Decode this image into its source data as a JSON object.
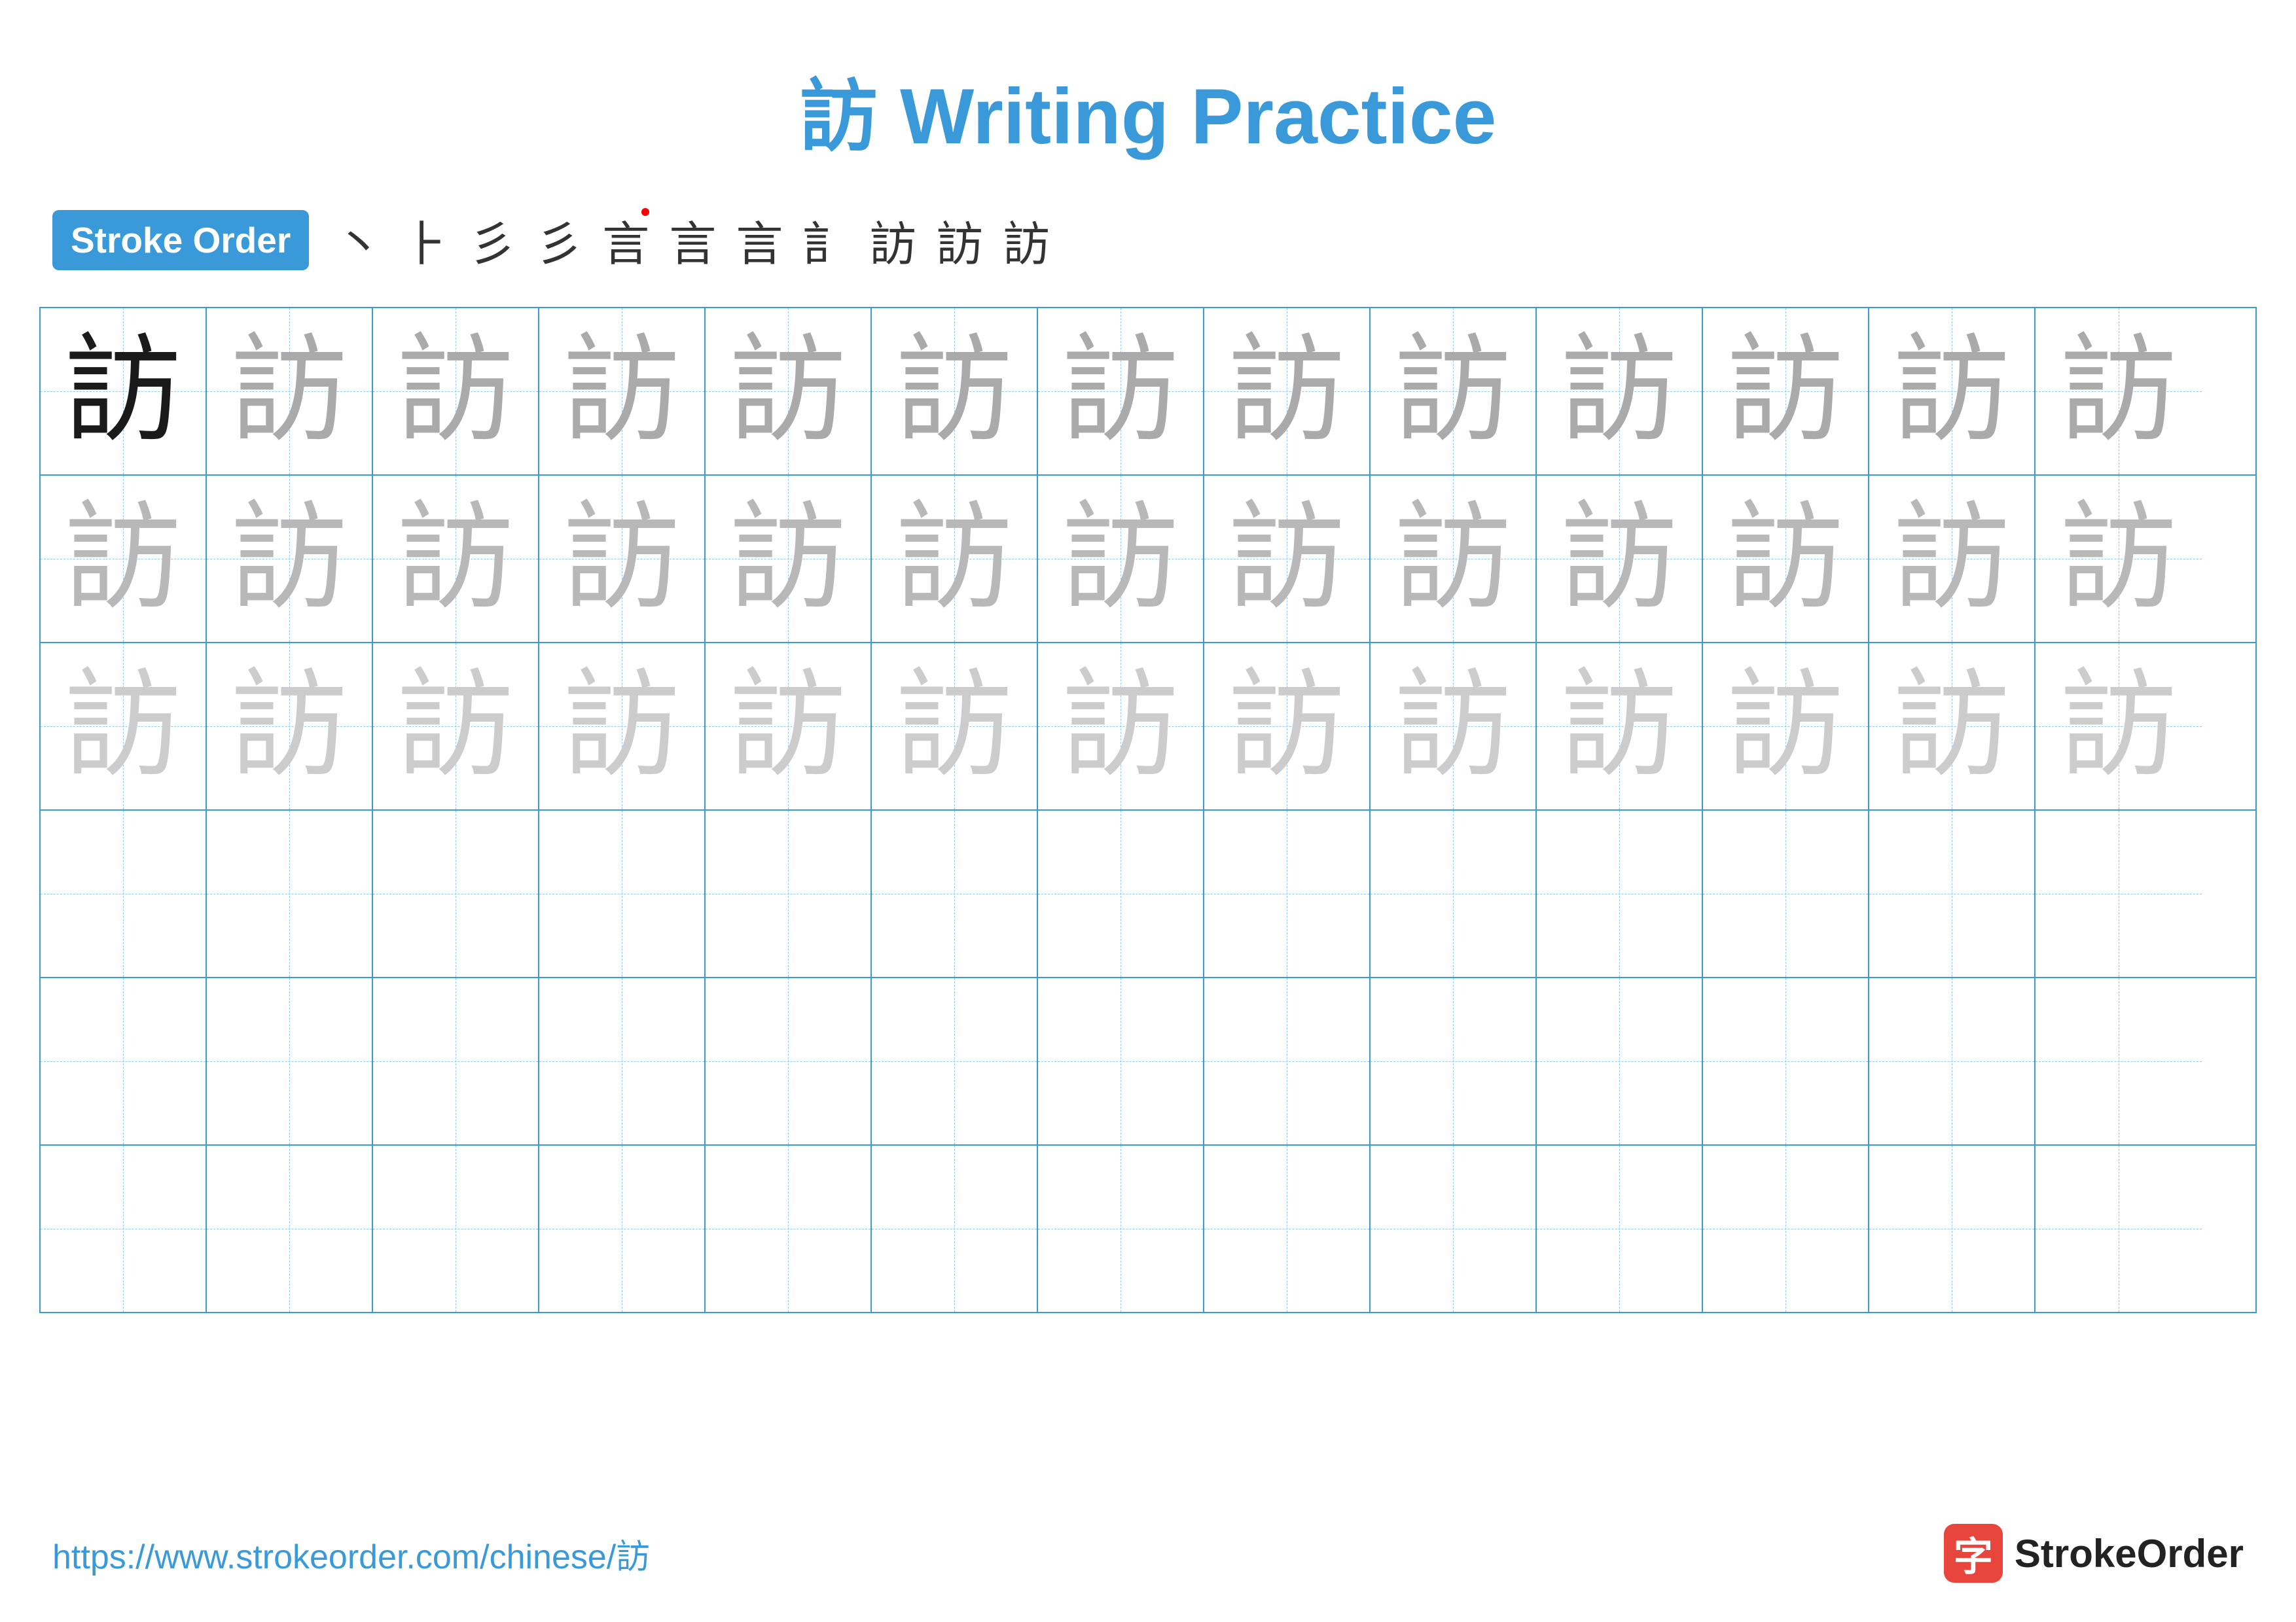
{
  "title": "訪 Writing Practice",
  "stroke_order": {
    "badge_label": "Stroke Order",
    "strokes": [
      "丶",
      "ㄧ",
      "ㄧ",
      "ㄧ",
      "言",
      "言",
      "言",
      "訁",
      "訪",
      "訪",
      "訪"
    ]
  },
  "character": "訪",
  "grid": {
    "cols": 13,
    "rows": 6,
    "practice_char": "訪"
  },
  "footer": {
    "url": "https://www.strokeorder.com/chinese/訪",
    "logo_char": "字",
    "logo_text": "StrokeOrder"
  }
}
